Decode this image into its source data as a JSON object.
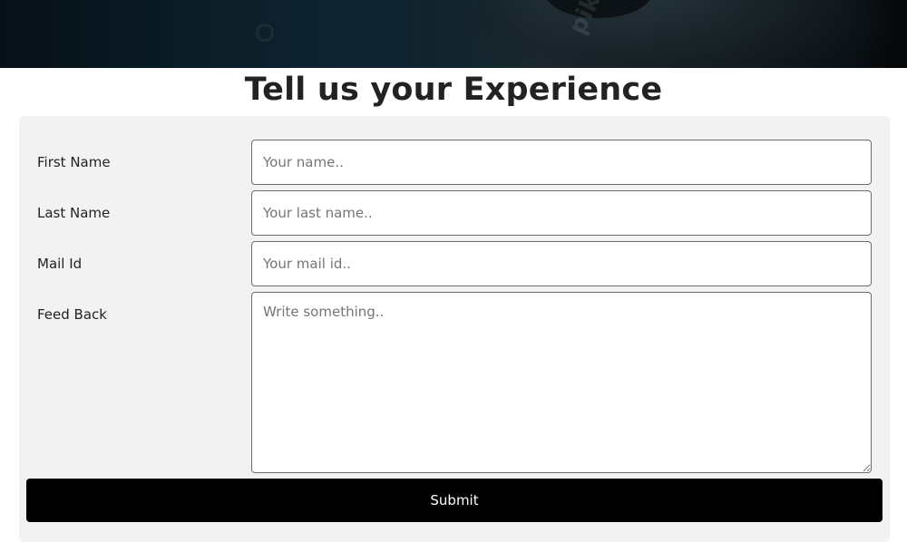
{
  "hero": {
    "watermark_text": "pik"
  },
  "page": {
    "title": "Tell us your Experience"
  },
  "form": {
    "first_name": {
      "label": "First Name",
      "placeholder": "Your name..",
      "value": ""
    },
    "last_name": {
      "label": "Last Name",
      "placeholder": "Your last name..",
      "value": ""
    },
    "mail_id": {
      "label": "Mail Id",
      "placeholder": "Your mail id..",
      "value": ""
    },
    "feedback": {
      "label": "Feed Back",
      "placeholder": "Write something..",
      "value": ""
    },
    "submit_label": "Submit"
  },
  "colors": {
    "panel_background": "#f2f2f2",
    "submit_background": "#000000",
    "submit_text": "#ffffff",
    "title_text": "#222222",
    "hero_background": "#0b1c26"
  }
}
